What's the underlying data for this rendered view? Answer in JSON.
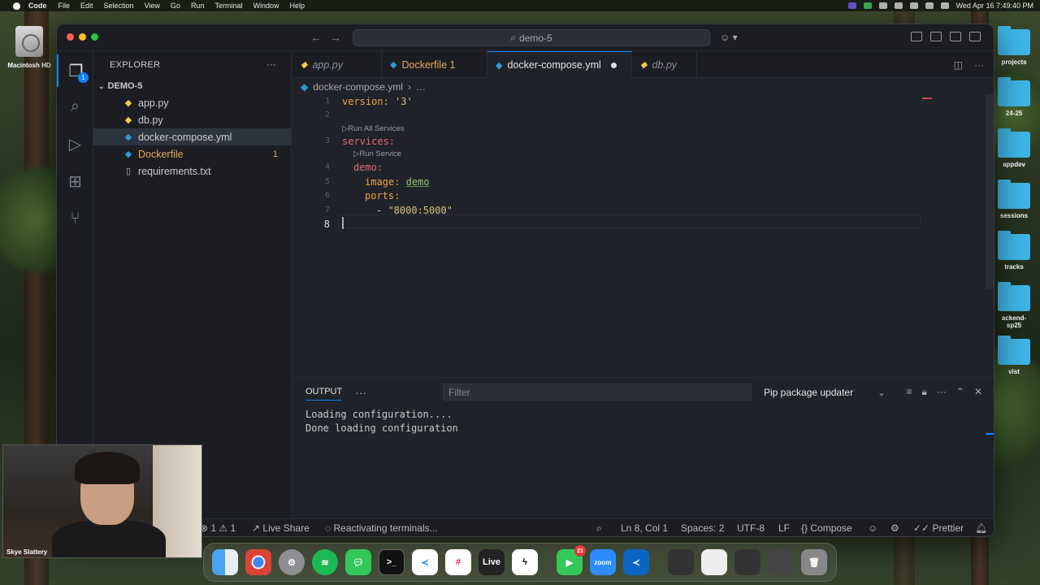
{
  "menubar": {
    "app": "Code",
    "items": [
      "File",
      "Edit",
      "Selection",
      "View",
      "Go",
      "Run",
      "Terminal",
      "Window",
      "Help"
    ],
    "clock": "Wed Apr 16  7:49:40 PM"
  },
  "desktop": {
    "disk_label": "Macintosh HD",
    "folders": [
      "projects",
      "24-25",
      "appdev",
      "sessions",
      "tracks",
      "ackend-sp25",
      "vist"
    ]
  },
  "window": {
    "command_center": "demo-5"
  },
  "activity_bar": {
    "explorer_badge": "1"
  },
  "explorer": {
    "title": "EXPLORER",
    "more": "···",
    "folder": "DEMO-5",
    "files": [
      {
        "name": "app.py",
        "icon": "python-icon"
      },
      {
        "name": "db.py",
        "icon": "python-icon"
      },
      {
        "name": "docker-compose.yml",
        "icon": "docker-icon"
      },
      {
        "name": "Dockerfile",
        "icon": "docker-icon",
        "problems": "1"
      },
      {
        "name": "requirements.txt",
        "icon": "text-file-icon"
      }
    ]
  },
  "tabs": [
    {
      "label": "app.py"
    },
    {
      "label": "Dockerfile 1"
    },
    {
      "label": "docker-compose.yml"
    },
    {
      "label": "db.py"
    }
  ],
  "breadcrumb": {
    "file": "docker-compose.yml",
    "rest": "…"
  },
  "editor": {
    "line_numbers": [
      "1",
      "2",
      "3",
      "4",
      "5",
      "6",
      "7",
      "8"
    ],
    "lens_run_all": "Run All Services",
    "lens_run_service": "Run Service",
    "lines": {
      "l1_key": "version:",
      "l1_val": "'3'",
      "l3_key": "services:",
      "l4_key": "demo:",
      "l5_key": "image:",
      "l5_val": "demo",
      "l6_key": "ports:",
      "l7_dash": "- ",
      "l7_val": "\"8000:5000\""
    }
  },
  "panel": {
    "tab": "OUTPUT",
    "more": "···",
    "filter_placeholder": "Filter",
    "channel": "Pip package updater",
    "output_lines": [
      "Loading configuration....",
      "Done loading configuration"
    ]
  },
  "statusbar": {
    "problems": "1",
    "warnings": "1",
    "live_share": "Live Share",
    "activity": "Reactivating terminals...",
    "position": "Ln 8, Col 1",
    "indent": "Spaces: 2",
    "encoding": "UTF-8",
    "eol": "LF",
    "language": "Compose",
    "formatter": "Prettier"
  },
  "webcam": {
    "name": "Skye Slattery"
  },
  "dock": {
    "live_label": "Live",
    "zoom_label": "zoom",
    "facetime_badge": "21"
  }
}
